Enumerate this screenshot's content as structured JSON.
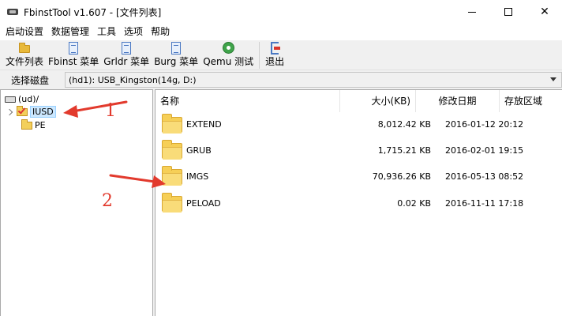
{
  "window": {
    "title": "FbinstTool v1.607 - [文件列表]"
  },
  "menu": [
    "启动设置",
    "数据管理",
    "工具",
    "选项",
    "帮助"
  ],
  "toolbar": {
    "items": [
      {
        "label": "文件列表",
        "icon": "folder-icon"
      },
      {
        "label": "Fbinst 菜单",
        "icon": "document-icon"
      },
      {
        "label": "Grldr 菜单",
        "icon": "document-icon"
      },
      {
        "label": "Burg 菜单",
        "icon": "document-icon"
      },
      {
        "label": "Qemu 测试",
        "icon": "qemu-icon"
      },
      {
        "label": "退出",
        "icon": "exit-icon"
      }
    ]
  },
  "disk": {
    "label": "选择磁盘",
    "value": "(hd1): USB_Kingston(14g, D:)"
  },
  "tree": {
    "root": "(ud)/",
    "items": [
      {
        "label": "IUSD",
        "selected": true
      },
      {
        "label": "PE",
        "selected": false
      }
    ]
  },
  "list": {
    "columns": [
      "名称",
      "大小(KB)",
      "修改日期",
      "存放区域"
    ],
    "rows": [
      {
        "name": "EXTEND",
        "size": "8,012.42 KB",
        "date": "2016-01-12 20:12",
        "area": ""
      },
      {
        "name": "GRUB",
        "size": "1,715.21 KB",
        "date": "2016-02-01 19:15",
        "area": ""
      },
      {
        "name": "IMGS",
        "size": "70,936.26 KB",
        "date": "2016-05-13 08:52",
        "area": ""
      },
      {
        "name": "PELOAD",
        "size": "0.02 KB",
        "date": "2016-11-11 17:18",
        "area": ""
      }
    ]
  },
  "annotations": {
    "label1": "1",
    "label2": "2",
    "color": "#e23a2d"
  }
}
